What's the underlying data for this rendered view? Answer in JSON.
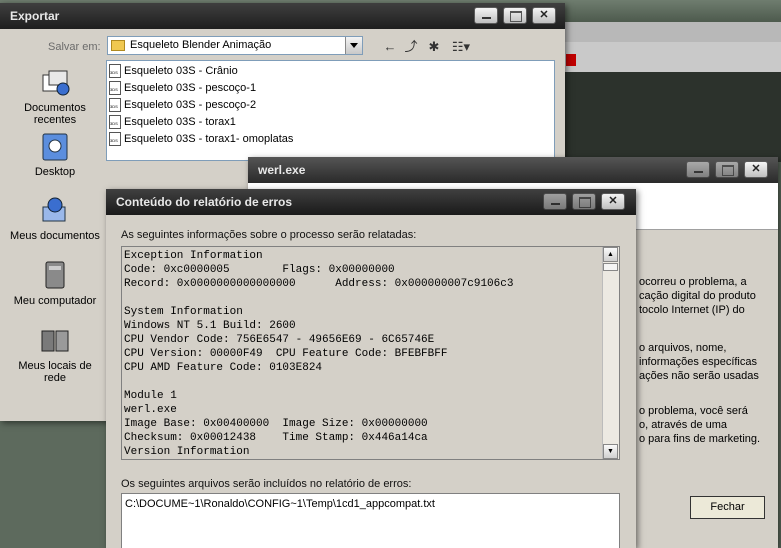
{
  "export_dialog": {
    "title": "Exportar",
    "save_in_label": "Salvar em:",
    "save_in_value": "Esqueleto Blender Animação",
    "places": [
      {
        "label": "Documentos recentes",
        "icon": "recent-documents-icon"
      },
      {
        "label": "Desktop",
        "icon": "desktop-icon"
      },
      {
        "label": "Meus documentos",
        "icon": "my-documents-icon"
      },
      {
        "label": "Meu computador",
        "icon": "my-computer-icon"
      },
      {
        "label": "Meus locais de rede",
        "icon": "network-places-icon"
      }
    ],
    "files": [
      "Esqueleto 03S - Crânio",
      "Esqueleto 03S - pescoço-1",
      "Esqueleto 03S - pescoço-2",
      "Esqueleto 03S - torax1",
      "Esqueleto 03S - torax1- omoplatas"
    ]
  },
  "werl_dialog": {
    "title": "werl.exe",
    "right_text": [
      "ocorreu o problema, a",
      "cação digital do produto",
      "tocolo Internet (IP) do",
      "",
      "o arquivos, nome,",
      "informações específicas",
      "ações não serão usadas",
      "",
      "o problema, você será",
      "o, através de uma",
      "o para fins de marketing."
    ],
    "close_button": "Fechar"
  },
  "error_report": {
    "title": "Conteúdo do relatório de erros",
    "intro": "As seguintes informações sobre o processo serão relatadas:",
    "report_lines": [
      "Exception Information",
      "Code: 0xc0000005        Flags: 0x00000000",
      "Record: 0x0000000000000000      Address: 0x000000007c9106c3",
      "",
      "System Information",
      "Windows NT 5.1 Build: 2600",
      "CPU Vendor Code: 756E6547 - 49656E69 - 6C65746E",
      "CPU Version: 00000F49  CPU Feature Code: BFEBFBFF",
      "CPU AMD Feature Code: 0103E824",
      "",
      "Module 1",
      "werl.exe",
      "Image Base: 0x00400000  Image Size: 0x00000000",
      "Checksum: 0x00012438    Time Stamp: 0x446a14ca",
      "Version Information"
    ],
    "files_label": "Os seguintes arquivos serão incluídos no relatório de erros:",
    "files_value": "C:\\DOCUME~1\\Ronaldo\\CONFIG~1\\Temp\\1cd1_appcompat.txt"
  },
  "colors": {
    "titlebar": "#2a2a2a",
    "dialog_bg": "#d4d0c8",
    "error_red": "#c00000"
  }
}
